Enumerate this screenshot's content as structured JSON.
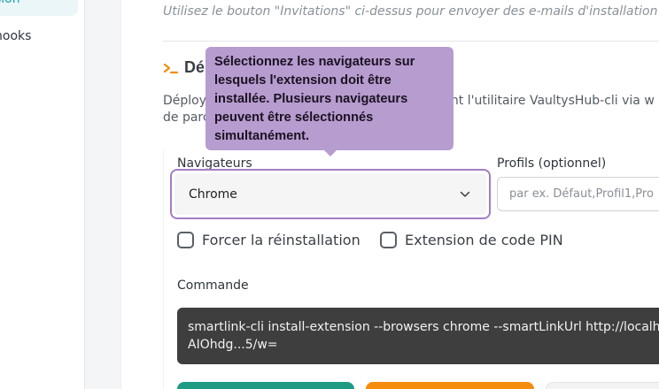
{
  "sidebar": {
    "items": [
      {
        "label": "sion",
        "active": true
      },
      {
        "label": "hooks",
        "active": false
      }
    ]
  },
  "main": {
    "invitations_hint": "Utilisez le bouton \"Invitations\" ci-dessus pour envoyer des e-mails d'installation c",
    "section": {
      "icon": "terminal-icon",
      "title": "Dé",
      "description_line1_start": "Déploy",
      "description_line1_end": "sant l'utilitaire VaultysHub-cli via w",
      "description_line2": "de parc"
    },
    "browsers": {
      "label": "Navigateurs",
      "selected": "Chrome",
      "icon": "chevron-down-icon"
    },
    "profiles": {
      "label": "Profils (optionnel)",
      "placeholder": "par ex. Défaut,Profil1,Pro"
    },
    "options": {
      "force_reinstall": "Forcer la réinstallation",
      "pin_extension": "Extension de code PIN"
    },
    "command": {
      "label": "Commande",
      "line1": "smartlink-cli install-extension --browsers chrome --smartLinkUrl http://localh",
      "line2": "AIOhdg...5/w="
    },
    "tooltip": {
      "text": "Sélectionnez les navigateurs sur lesquels l'extension doit être installée. Plusieurs navigateurs peuvent être sélectionnés simultanément."
    }
  },
  "colors": {
    "accent_teal": "#1ba1b4",
    "section_icon_orange": "#f58c0d",
    "tooltip_purple": "#b79cd0",
    "focus_border": "#a37ec4",
    "button_green": "#1f9b83",
    "button_orange": "#f58c0d",
    "command_bg": "#3e3e3e"
  }
}
